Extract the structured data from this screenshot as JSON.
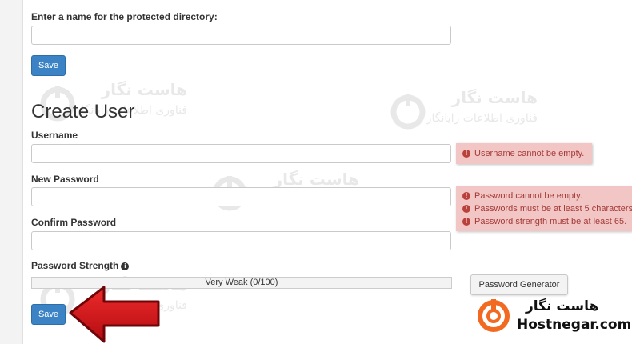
{
  "protected_dir": {
    "label": "Enter a name for the protected directory:",
    "value": "",
    "save_label": "Save"
  },
  "create_user": {
    "title": "Create User",
    "username_label": "Username",
    "username_value": "",
    "new_password_label": "New Password",
    "new_password_value": "",
    "confirm_password_label": "Confirm Password",
    "confirm_password_value": "",
    "strength_label": "Password Strength",
    "strength_text": "Very Weak (0/100)",
    "strength_value": 0,
    "generator_label": "Password Generator",
    "save_label": "Save"
  },
  "errors": {
    "username": [
      "Username cannot be empty."
    ],
    "password": [
      "Password cannot be empty.",
      "Passwords must be at least 5 characters",
      "Password strength must be at least 65."
    ]
  },
  "watermark": {
    "name_fa": "هاست نگار",
    "subtitle_fa": "فناوری اطلاعات رایانگار"
  },
  "brand": {
    "name_fa": "هاست نگار",
    "name_en": "Hostnegar.com"
  },
  "colors": {
    "primary_button": "#3b83c5",
    "error_bg": "#f2c6c5",
    "error_text": "#a33a37",
    "arrow": "#d0151c",
    "brand_orange": "#f26a21"
  },
  "icons": [
    "error-circle-icon",
    "info-icon",
    "red-arrow",
    "hostnegar-logo-icon"
  ]
}
